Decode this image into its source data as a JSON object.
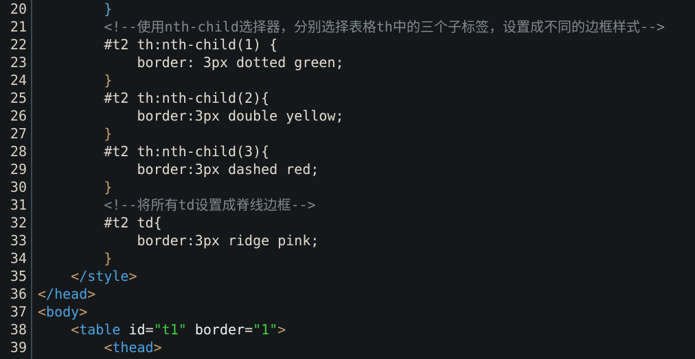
{
  "editor": {
    "theme": "dark",
    "language": "HTML",
    "background_color": "#15181b",
    "gutter_separator_color": "#3b4b54",
    "line_number_color": "#d9d2c3",
    "first_visible_line": 20,
    "last_visible_line": 39,
    "line_height_px": 26,
    "font_size_px": 20
  },
  "colors": {
    "comment": "#7f8a8f",
    "tag": "#4aa3e0",
    "attribute_name": "#f2f2f2",
    "attribute_value": "#3dd13d",
    "bracket": "#c8a06a",
    "plain_text": "#e4ddd0"
  },
  "lines": [
    {
      "number": "20",
      "tokens": [
        {
          "text": "        ",
          "type": "plain"
        },
        {
          "text": "}",
          "type": "brace-b"
        }
      ]
    },
    {
      "number": "21",
      "tokens": [
        {
          "text": "        ",
          "type": "plain"
        },
        {
          "text": "<!--使用nth-child选择器，分别选择表格th中的三个子标签，设置成不同的边框样式-->",
          "type": "comment"
        }
      ]
    },
    {
      "number": "22",
      "tokens": [
        {
          "text": "        ",
          "type": "plain"
        },
        {
          "text": "#t2 th:nth-child(1) {",
          "type": "plain"
        }
      ]
    },
    {
      "number": "23",
      "tokens": [
        {
          "text": "            ",
          "type": "plain"
        },
        {
          "text": "border: 3px dotted green;",
          "type": "plain"
        }
      ]
    },
    {
      "number": "24",
      "tokens": [
        {
          "text": "        ",
          "type": "plain"
        },
        {
          "text": "}",
          "type": "brace-y"
        }
      ]
    },
    {
      "number": "25",
      "tokens": [
        {
          "text": "        ",
          "type": "plain"
        },
        {
          "text": "#t2 th:nth-child(2){",
          "type": "plain"
        }
      ]
    },
    {
      "number": "26",
      "tokens": [
        {
          "text": "            ",
          "type": "plain"
        },
        {
          "text": "border:3px double yellow;",
          "type": "plain"
        }
      ]
    },
    {
      "number": "27",
      "tokens": [
        {
          "text": "        ",
          "type": "plain"
        },
        {
          "text": "}",
          "type": "brace-y"
        }
      ]
    },
    {
      "number": "28",
      "tokens": [
        {
          "text": "        ",
          "type": "plain"
        },
        {
          "text": "#t2 th:nth-child(3){",
          "type": "plain"
        }
      ]
    },
    {
      "number": "29",
      "tokens": [
        {
          "text": "            ",
          "type": "plain"
        },
        {
          "text": "border:3px dashed red;",
          "type": "plain"
        }
      ]
    },
    {
      "number": "30",
      "tokens": [
        {
          "text": "        ",
          "type": "plain"
        },
        {
          "text": "}",
          "type": "brace-y"
        }
      ]
    },
    {
      "number": "31",
      "tokens": [
        {
          "text": "        ",
          "type": "plain"
        },
        {
          "text": "<!--将所有td设置成脊线边框-->",
          "type": "comment"
        }
      ]
    },
    {
      "number": "32",
      "tokens": [
        {
          "text": "        ",
          "type": "plain"
        },
        {
          "text": "#t2 td{",
          "type": "plain"
        }
      ]
    },
    {
      "number": "33",
      "tokens": [
        {
          "text": "            ",
          "type": "plain"
        },
        {
          "text": "border:3px ridge pink;",
          "type": "plain"
        }
      ]
    },
    {
      "number": "34",
      "tokens": [
        {
          "text": "        ",
          "type": "plain"
        },
        {
          "text": "}",
          "type": "brace-y"
        }
      ]
    },
    {
      "number": "35",
      "tokens": [
        {
          "text": "    ",
          "type": "plain"
        },
        {
          "text": "<",
          "type": "bracket"
        },
        {
          "text": "/style",
          "type": "tag"
        },
        {
          "text": ">",
          "type": "bracket"
        }
      ]
    },
    {
      "number": "36",
      "tokens": [
        {
          "text": "<",
          "type": "bracket"
        },
        {
          "text": "/head",
          "type": "tag"
        },
        {
          "text": ">",
          "type": "bracket"
        }
      ]
    },
    {
      "number": "37",
      "tokens": [
        {
          "text": "<",
          "type": "bracket"
        },
        {
          "text": "body",
          "type": "tag"
        },
        {
          "text": ">",
          "type": "bracket"
        }
      ]
    },
    {
      "number": "38",
      "tokens": [
        {
          "text": "    ",
          "type": "plain"
        },
        {
          "text": "<",
          "type": "bracket"
        },
        {
          "text": "table",
          "type": "tag"
        },
        {
          "text": " ",
          "type": "plain"
        },
        {
          "text": "id",
          "type": "attr"
        },
        {
          "text": "=",
          "type": "eq"
        },
        {
          "text": "\"t1\"",
          "type": "string"
        },
        {
          "text": " ",
          "type": "plain"
        },
        {
          "text": "border",
          "type": "attr"
        },
        {
          "text": "=",
          "type": "eq"
        },
        {
          "text": "\"1\"",
          "type": "string"
        },
        {
          "text": ">",
          "type": "bracket"
        }
      ]
    },
    {
      "number": "39",
      "tokens": [
        {
          "text": "        ",
          "type": "plain"
        },
        {
          "text": "<",
          "type": "bracket"
        },
        {
          "text": "thead",
          "type": "tag"
        },
        {
          "text": ">",
          "type": "bracket"
        }
      ]
    }
  ]
}
